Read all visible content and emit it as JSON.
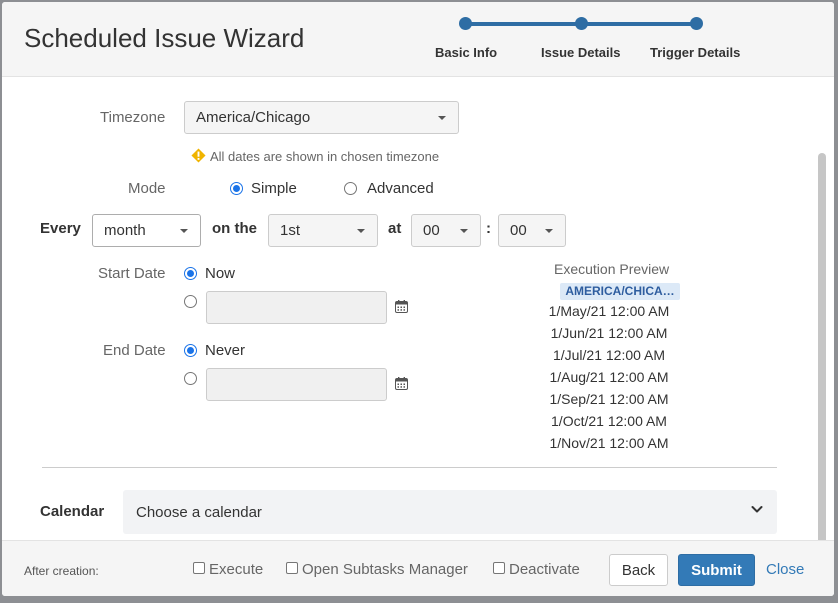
{
  "header": {
    "title": "Scheduled Issue Wizard",
    "steps": [
      {
        "label": "Basic Info"
      },
      {
        "label": "Issue Details"
      },
      {
        "label": "Trigger Details"
      }
    ]
  },
  "form": {
    "timezone": {
      "label": "Timezone",
      "value": "America/Chicago",
      "note": "All dates are shown in chosen timezone"
    },
    "mode": {
      "label": "Mode",
      "options": [
        "Simple",
        "Advanced"
      ],
      "selected": "Simple"
    },
    "schedule": {
      "every_label": "Every",
      "period_value": "month",
      "on_the_label": "on the",
      "day_value": "1st",
      "at_label": "at",
      "hour_value": "00",
      "colon": ":",
      "minute_value": "00"
    },
    "start_date": {
      "label": "Start Date",
      "option_now": "Now",
      "selected": "Now"
    },
    "end_date": {
      "label": "End Date",
      "option_never": "Never",
      "selected": "Never"
    },
    "calendar": {
      "label": "Calendar",
      "placeholder": "Choose a calendar"
    }
  },
  "preview": {
    "title": "Execution Preview",
    "timezone_badge": "AMERICA/CHICA…",
    "items": [
      "1/May/21 12:00 AM",
      "1/Jun/21 12:00 AM",
      "1/Jul/21 12:00 AM",
      "1/Aug/21 12:00 AM",
      "1/Sep/21 12:00 AM",
      "1/Oct/21 12:00 AM",
      "1/Nov/21 12:00 AM"
    ]
  },
  "footer": {
    "after_label": "After creation:",
    "checkboxes": [
      {
        "label": "Execute",
        "checked": false
      },
      {
        "label": "Open Subtasks Manager",
        "checked": false
      },
      {
        "label": "Deactivate",
        "checked": false
      }
    ],
    "back_label": "Back",
    "submit_label": "Submit",
    "close_label": "Close"
  },
  "colors": {
    "primary": "#337ab7",
    "wizard": "#2e6da4",
    "radio_selected": "#1a73e8",
    "warning": "#f0b400"
  }
}
